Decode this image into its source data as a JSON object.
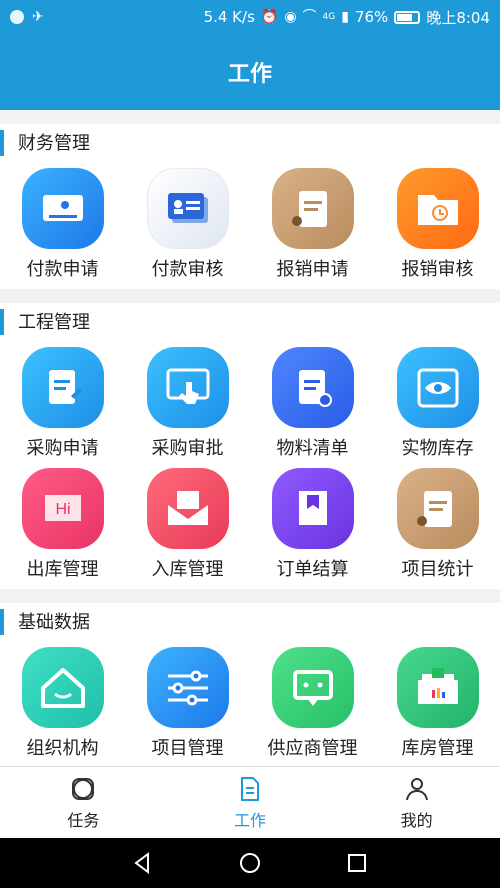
{
  "status": {
    "speed": "5.4 K/s",
    "network": "4G",
    "battery": "76%",
    "time": "晚上8:04"
  },
  "header": {
    "title": "工作"
  },
  "sections": [
    {
      "title": "财务管理",
      "items": [
        {
          "label": "付款申请",
          "icon": "payment-request-icon"
        },
        {
          "label": "付款审核",
          "icon": "payment-review-icon"
        },
        {
          "label": "报销申请",
          "icon": "reimbursement-request-icon"
        },
        {
          "label": "报销审核",
          "icon": "reimbursement-review-icon"
        }
      ]
    },
    {
      "title": "工程管理",
      "items": [
        {
          "label": "采购申请",
          "icon": "purchase-request-icon"
        },
        {
          "label": "采购审批",
          "icon": "purchase-approval-icon"
        },
        {
          "label": "物料清单",
          "icon": "material-list-icon"
        },
        {
          "label": "实物库存",
          "icon": "inventory-icon"
        },
        {
          "label": "出库管理",
          "icon": "outbound-icon"
        },
        {
          "label": "入库管理",
          "icon": "inbound-icon"
        },
        {
          "label": "订单结算",
          "icon": "order-settlement-icon"
        },
        {
          "label": "项目统计",
          "icon": "project-stats-icon"
        }
      ]
    },
    {
      "title": "基础数据",
      "items": [
        {
          "label": "组织机构",
          "icon": "organization-icon"
        },
        {
          "label": "项目管理",
          "icon": "project-manage-icon"
        },
        {
          "label": "供应商管理",
          "icon": "supplier-icon"
        },
        {
          "label": "库房管理",
          "icon": "warehouse-icon"
        }
      ]
    }
  ],
  "tabs": [
    {
      "label": "任务",
      "icon": "task-icon",
      "active": false
    },
    {
      "label": "工作",
      "icon": "work-doc-icon",
      "active": true
    },
    {
      "label": "我的",
      "icon": "profile-icon",
      "active": false
    }
  ]
}
